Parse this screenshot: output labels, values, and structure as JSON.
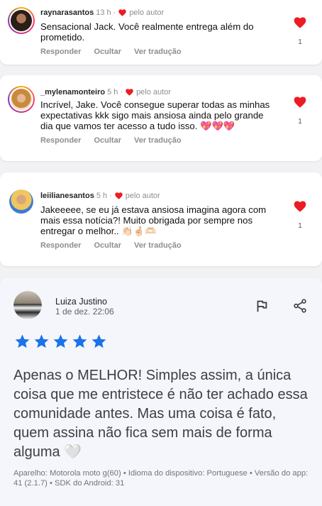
{
  "comments": [
    {
      "username": "raynarasantos",
      "time": "13 h",
      "author_badge": "pelo autor",
      "text": "Sensacional Jack. Você realmente entrega além do prometido.",
      "reply": "Responder",
      "hide": "Ocultar",
      "translate": "Ver tradução",
      "likes": "1"
    },
    {
      "username": "_mylenamonteiro",
      "time": "5 h",
      "author_badge": "pelo autor",
      "text": "Incrível, Jake. Você consegue superar todas as minhas expectativas kkk sigo mais ansiosa ainda pelo grande dia que vamos ter acesso a tudo isso. 💖💖💖",
      "reply": "Responder",
      "hide": "Ocultar",
      "translate": "Ver tradução",
      "likes": "1"
    },
    {
      "username": "leiilianesantos",
      "time": "5 h",
      "author_badge": "pelo autor",
      "text": "Jakeeeee, se eu já estava ansiosa imagina agora com mais essa notícia?! Muito obrigada por sempre nos entregar o melhor.. 👏🏻🤞🏻🫶🏻",
      "reply": "Responder",
      "hide": "Ocultar",
      "translate": "Ver tradução",
      "likes": "1"
    }
  ],
  "review": {
    "name": "Luiza Justino",
    "date": "1 de dez. 22:06",
    "rating": 5,
    "text": "Apenas o MELHOR! Simples assim, a única coisa que me entristece é não ter achado essa comunidade antes. Mas uma coisa é fato, quem assina não fica sem mais de forma alguma 🤍",
    "device_info": "Aparelho: Motorola moto g(60) • Idioma do dispositivo: Portuguese • Versão do app: 41 (2.1.7) • SDK do Android: 31"
  },
  "colors": {
    "heart": "#ed1c24",
    "star": "#1a73e8",
    "gray_text": "#8e8e8e"
  },
  "icons": [
    "heart-icon",
    "flag-icon",
    "share-icon",
    "star-icon"
  ]
}
